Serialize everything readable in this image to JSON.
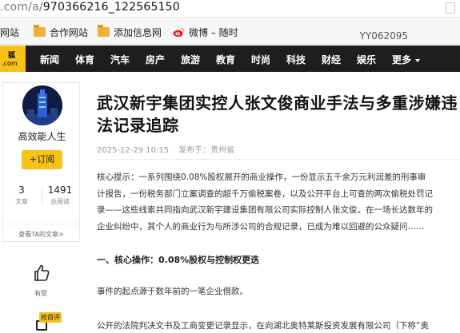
{
  "browser": {
    "url_prefix": ".com/a/",
    "url_path": "970366216_122565150"
  },
  "bookmarks": {
    "items": [
      {
        "label": "网站"
      },
      {
        "label": "合作网站"
      },
      {
        "label": "添加信息网"
      },
      {
        "label": "微博 – 随时"
      }
    ],
    "right_text": "YY062095"
  },
  "nav": {
    "logo_top": "狐",
    "logo_bottom": ".com",
    "items": [
      "新闻",
      "体育",
      "汽车",
      "房产",
      "旅游",
      "教育",
      "时尚",
      "科技",
      "财经",
      "娱乐",
      "更多"
    ]
  },
  "author": {
    "name": "高效能人生",
    "follow_label": "+订阅",
    "articles_count": "3",
    "articles_label": "文章",
    "reads_count": "1491",
    "reads_label": "总阅读",
    "see_more": "查看TA的文章>"
  },
  "article": {
    "title": "武汉新宇集团实控人张文俊商业手法与多重涉嫌违法记录追踪",
    "date": "2025-12-29 10:15",
    "source": "发布于：贵州省",
    "summary_lines": [
      "核心提示：一系列围绕0.08%股权展开的商业操作，一份显示五千余万元利润差的刑事审",
      "计报告，一份税务部门立案调查的超千万偷税案卷，以及公开平台上可查的两次偷税处罚记",
      "录——这些线索共同指向武汉新宇建设集团有限公司实际控制人张文俊。在一场长达数年的",
      "企业纠纷中，其个人的商业行为与所涉公司的合规记录，已成为难以回避的公众疑问……"
    ],
    "section1_heading": "一、核心操作：0.08%股权与控制权更迭",
    "para1": "事件的起点源于数年前的一笔企业借款。",
    "para2": "公开的法院判决文书及工商变更记录显示，在向湖北奥特莱斯投资发展有限公司（下称“奥"
  },
  "actions": {
    "like_label": "有赞",
    "comment_badge": "抢首评"
  }
}
